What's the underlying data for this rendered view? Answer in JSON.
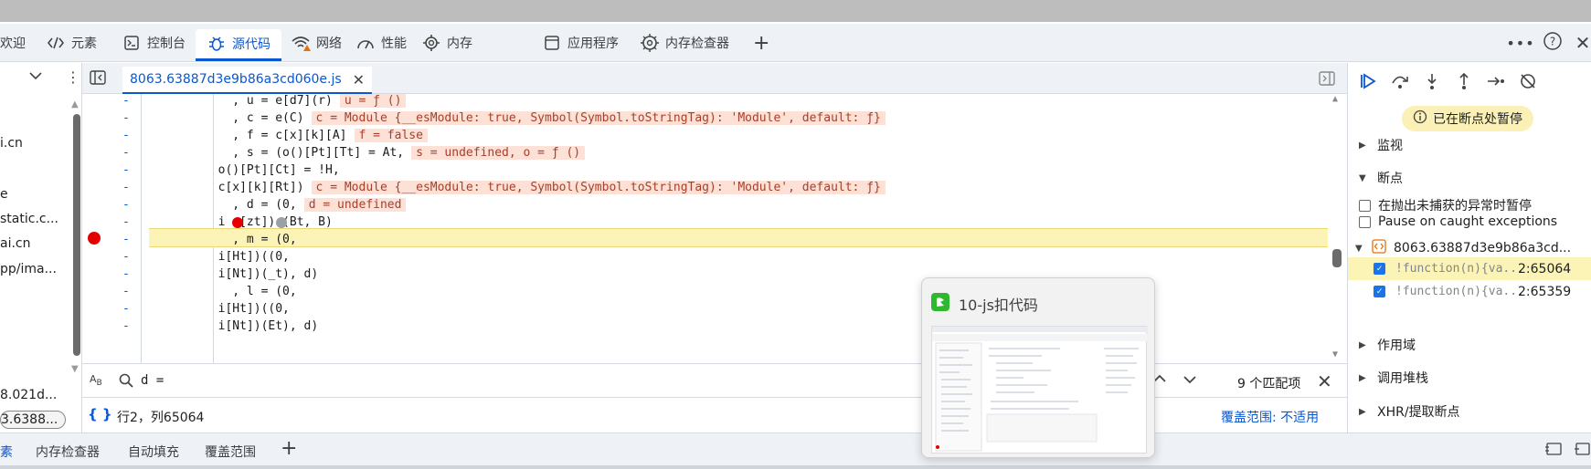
{
  "tabs": [
    {
      "label": "欢迎",
      "icon": "welcome-icon"
    },
    {
      "label": "元素",
      "icon": "code-tag-icon"
    },
    {
      "label": "控制台",
      "icon": "console-icon"
    },
    {
      "label": "源代码",
      "icon": "bug-icon"
    },
    {
      "label": "网络",
      "icon": "wifi-warning-icon"
    },
    {
      "label": "性能",
      "icon": "gauge-icon"
    },
    {
      "label": "内存",
      "icon": "chip-icon"
    },
    {
      "label": "应用程序",
      "icon": "app-window-icon"
    },
    {
      "label": "内存检查器",
      "icon": "memory-inspector-icon"
    }
  ],
  "colors": {
    "accent": "#0b57d0",
    "breakpoint": "#e50000",
    "highlight": "#fcf4b6",
    "inline_value_bg": "#fde0d6"
  },
  "left_pane": {
    "items": [
      "i.cn",
      "e",
      "static.c...",
      "ai.cn",
      "pp/ima...",
      "8.021d...",
      "3.6388..."
    ]
  },
  "editor": {
    "file_name": "8063.63887d3e9b86a3cd060e.js",
    "lines": [
      {
        "code": "          , u = e[d7](r)",
        "inline": "u = ƒ ()"
      },
      {
        "code": "          , c = e(C)",
        "inline": "c = Module {__esModule: true, Symbol(Symbol.toStringTag): 'Module', default: ƒ}"
      },
      {
        "code": "          , f = c[x][k][A]",
        "inline": "f = false"
      },
      {
        "code": "          , s = (o()[Pt][Tt] = At,",
        "inline": "s = undefined, o = ƒ ()"
      },
      {
        "code": "        o()[Pt][Ct] = !H,",
        "inline": ""
      },
      {
        "code": "        c[x][k][Rt])",
        "inline": "c = Module {__esModule: true, Symbol(Symbol.toStringTag): 'Module', default: ƒ}"
      },
      {
        "code": "          , d = (0,",
        "inline": "d = undefined"
      },
      {
        "code": "        i  [zt]) (Bt, B)",
        "inline": ""
      },
      {
        "code": "          , m = (0,",
        "inline": ""
      },
      {
        "code": "        i[Ht])((0,",
        "inline": ""
      },
      {
        "code": "        i[Nt])(_t), d)",
        "inline": ""
      },
      {
        "code": "          , l = (0,",
        "inline": ""
      },
      {
        "code": "        i[Ht])((0,",
        "inline": ""
      },
      {
        "code": "        i[Nt])(Et), d)",
        "inline": ""
      }
    ]
  },
  "search": {
    "query": "d =",
    "match_count": "9 个匹配项"
  },
  "status": {
    "position": "行2，列65064",
    "coverage": "覆盖范围: 不适用"
  },
  "drawer_tabs": [
    "素",
    "内存检查器",
    "自动填充",
    "覆盖范围"
  ],
  "debugger": {
    "paused_label": "已在断点处暂停",
    "sections": {
      "watch": "监视",
      "breakpoints": "断点",
      "scope": "作用域",
      "call_stack": "调用堆栈",
      "xhr": "XHR/提取断点"
    },
    "options": [
      {
        "label": "在抛出未捕获的异常时暂停",
        "checked": false
      },
      {
        "label": "Pause on caught exceptions",
        "checked": false
      }
    ],
    "bp_file": "8063.63887d3e9b86a3cd...",
    "bp_items": [
      {
        "code": "!function(n){va...",
        "loc": "2:65064",
        "checked": true
      },
      {
        "code": "!function(n){va...",
        "loc": "2:65359",
        "checked": true
      }
    ]
  },
  "popup": {
    "title": "10-js扣代码"
  }
}
